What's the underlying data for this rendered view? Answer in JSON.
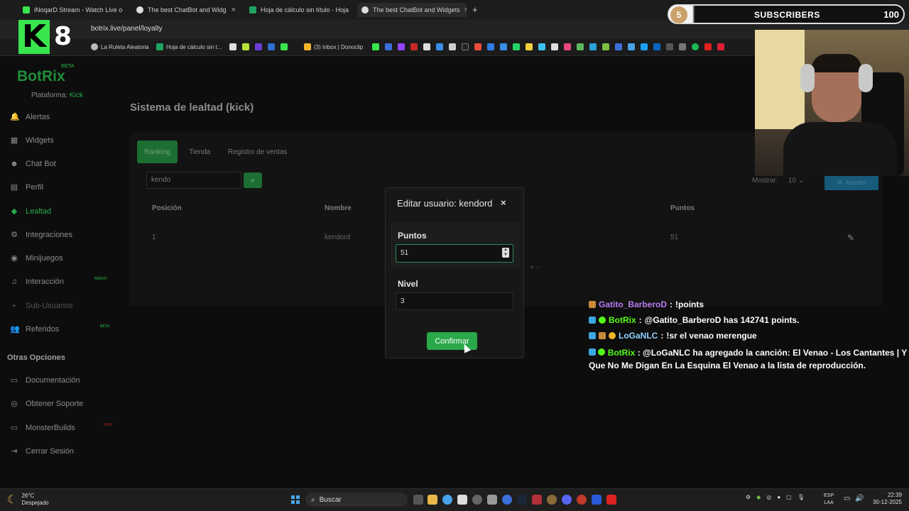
{
  "browser": {
    "tabs": [
      {
        "label": "iNoqarD Stream - Watch Live o",
        "icon": "kick-icon",
        "color": "#38e54d"
      },
      {
        "label": "The best ChatBot and Widg",
        "icon": "botrix-icon",
        "color": "#ddd"
      },
      {
        "label": "Hoja de cálculo sin título - Hoja",
        "icon": "sheets-icon",
        "color": "#1fa463"
      },
      {
        "label": "The best ChatBot and Widgets",
        "icon": "botrix-icon",
        "color": "#ddd"
      }
    ],
    "new_tab": "+",
    "url": "botrix.live/panel/loyalty",
    "bookmarks": [
      {
        "label": "La Ruleta Aleatoria"
      },
      {
        "label": "Hoja de cálculo sin t..."
      },
      {
        "label": "(3) Inbox | Donoclip"
      }
    ]
  },
  "overlay": {
    "logo_letter": "K",
    "logo_number": "8",
    "subscribers_circle": "5",
    "subscribers_label": "SUBSCRIBERS",
    "subscribers_count": "100"
  },
  "sidebar": {
    "brand": "BotRix",
    "beta": "BETA",
    "platform_label": "Plataforma:",
    "platform_value": "Kick",
    "items": [
      {
        "label": "Alertas",
        "icon": "bell-icon"
      },
      {
        "label": "Widgets",
        "icon": "grid-icon"
      },
      {
        "label": "Chat Bot",
        "icon": "robot-icon"
      },
      {
        "label": "Perfil",
        "icon": "profile-icon"
      },
      {
        "label": "Lealtad",
        "icon": "gem-icon"
      },
      {
        "label": "Integraciones",
        "icon": "plug-icon"
      },
      {
        "label": "Minijuegos",
        "icon": "gamepad-icon"
      },
      {
        "label": "Interacción",
        "icon": "music-icon",
        "badge": "NUEVO"
      },
      {
        "label": "Sub-Usuarios",
        "icon": "users-icon"
      },
      {
        "label": "Referidos",
        "icon": "referral-icon",
        "badge": "BETA"
      }
    ],
    "section2_title": "Otras Opciones",
    "items2": [
      {
        "label": "Documentación",
        "icon": "doc-icon"
      },
      {
        "label": "Obtener Soporte",
        "icon": "support-icon"
      },
      {
        "label": "MonsterBuilds",
        "icon": "monitor-icon",
        "badge": "NEW"
      },
      {
        "label": "Cerrar Sesión",
        "icon": "logout-icon"
      }
    ]
  },
  "main": {
    "title": "Sistema de lealtad (kick)",
    "tabs": [
      "Ranking",
      "Tienda",
      "Registro de ventas"
    ],
    "search_value": "kendo",
    "show_label": "Mostrar:",
    "show_value": "10",
    "settings_label": "Ajustes",
    "columns": [
      "Posición",
      "Nombre",
      "Puntos"
    ],
    "rows": [
      {
        "pos": "1",
        "name": "kendord",
        "points": "51"
      }
    ]
  },
  "modal": {
    "title": "Editar usuario: kendord",
    "close": "×",
    "points_label": "Puntos",
    "points_value": "51",
    "level_label": "Nivel",
    "level_value": "3",
    "confirm_label": "Confirmar"
  },
  "chat": [
    {
      "user": "Gatito_BarberoD",
      "sep": " : ",
      "msg": "!points",
      "color": "#b77bf2"
    },
    {
      "user": "BotRix",
      "sep": " : ",
      "msg": "@Gatito_BarberoD has 142741 points.",
      "color": "#53fc18"
    },
    {
      "user": "LoGaNLC",
      "sep": " : ",
      "msg": "!sr el venao merengue",
      "color": "#8fd0ff"
    },
    {
      "user": "BotRix",
      "sep": " : ",
      "msg": "@LoGaNLC ha agregado la canción: El Venao - Los Cantantes | Y Que No Me Digan En La Esquina El Venao a la lista de reproducción.",
      "color": "#53fc18"
    }
  ],
  "taskbar": {
    "temp": "26°C",
    "weather": "Despejado",
    "search": "Buscar",
    "lang1": "ESP",
    "lang2": "LAA",
    "time": "22:39",
    "date": "30-12-2025"
  }
}
